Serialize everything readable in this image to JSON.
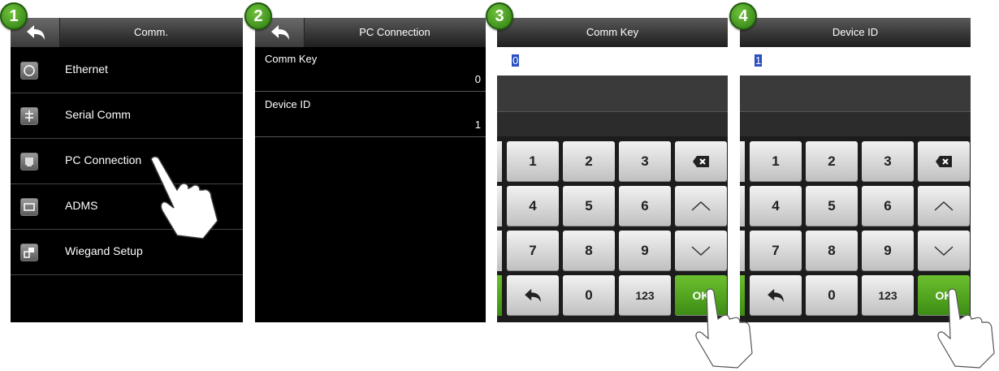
{
  "steps": [
    "1",
    "2",
    "3",
    "4"
  ],
  "screen1": {
    "title": "Comm.",
    "items": [
      {
        "label": "Ethernet",
        "icon": "ethernet-icon"
      },
      {
        "label": "Serial Comm",
        "icon": "serial-icon"
      },
      {
        "label": "PC Connection",
        "icon": "pc-connection-icon"
      },
      {
        "label": "ADMS",
        "icon": "adms-icon"
      },
      {
        "label": "Wiegand Setup",
        "icon": "wiegand-icon"
      }
    ]
  },
  "screen2": {
    "title": "PC Connection",
    "rows": [
      {
        "label": "Comm Key",
        "value": "0"
      },
      {
        "label": "Device ID",
        "value": "1"
      }
    ]
  },
  "screen3": {
    "title": "Comm Key",
    "input_value": "0",
    "keys": [
      "1",
      "2",
      "3",
      "4",
      "5",
      "6",
      "7",
      "8",
      "9",
      "0",
      "123",
      "OK"
    ]
  },
  "screen4": {
    "title": "Device ID",
    "input_value": "1",
    "keys": [
      "1",
      "2",
      "3",
      "4",
      "5",
      "6",
      "7",
      "8",
      "9",
      "0",
      "123",
      "OK"
    ]
  },
  "colors": {
    "accent": "#3c8c14",
    "selection": "#2a4fc2",
    "panel": "#000000"
  }
}
